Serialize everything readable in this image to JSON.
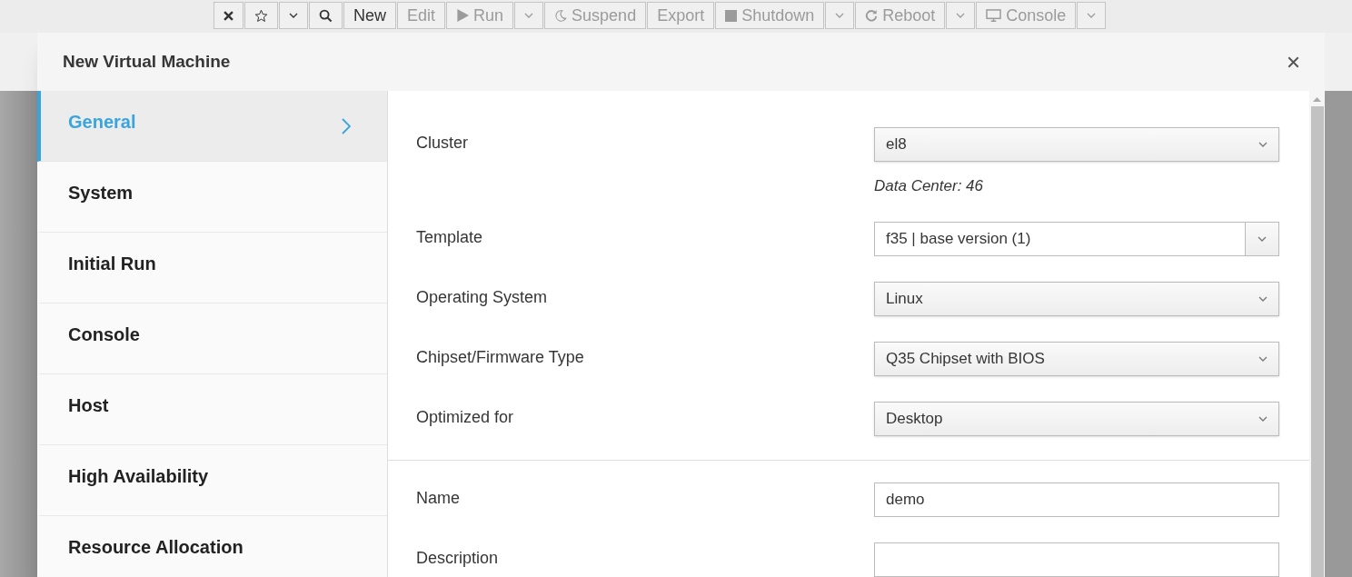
{
  "toolbar": [
    {
      "kind": "close"
    },
    {
      "kind": "star"
    },
    {
      "kind": "caret"
    },
    {
      "kind": "search"
    },
    {
      "kind": "text",
      "label": "New"
    },
    {
      "kind": "text",
      "label": "Edit",
      "disabled": true
    },
    {
      "kind": "run",
      "label": "Run",
      "disabled": true
    },
    {
      "kind": "caret",
      "disabled": true
    },
    {
      "kind": "suspend",
      "label": "Suspend",
      "disabled": true
    },
    {
      "kind": "text",
      "label": "Export",
      "disabled": true
    },
    {
      "kind": "shutdown",
      "label": "Shutdown",
      "disabled": true
    },
    {
      "kind": "caret",
      "disabled": true
    },
    {
      "kind": "reboot",
      "label": "Reboot",
      "disabled": true
    },
    {
      "kind": "caret",
      "disabled": true
    },
    {
      "kind": "console",
      "label": "Console",
      "disabled": true
    },
    {
      "kind": "caret",
      "disabled": true
    }
  ],
  "dialog": {
    "title": "New Virtual Machine",
    "sidebar": {
      "items": [
        {
          "label": "General",
          "selected": true
        },
        {
          "label": "System",
          "selected": false
        },
        {
          "label": "Initial Run",
          "selected": false
        },
        {
          "label": "Console",
          "selected": false
        },
        {
          "label": "Host",
          "selected": false
        },
        {
          "label": "High Availability",
          "selected": false
        },
        {
          "label": "Resource Allocation",
          "selected": false
        }
      ]
    },
    "sections": [
      [
        {
          "kind": "select",
          "label": "Cluster",
          "value": "el8",
          "helper": "Data Center: 46"
        },
        {
          "kind": "combo",
          "label": "Template",
          "value": "f35 | base version (1)"
        },
        {
          "kind": "select",
          "label": "Operating System",
          "value": "Linux"
        },
        {
          "kind": "select",
          "label": "Chipset/Firmware Type",
          "value": "Q35 Chipset with BIOS"
        },
        {
          "kind": "select",
          "label": "Optimized for",
          "value": "Desktop"
        }
      ],
      [
        {
          "kind": "text",
          "label": "Name",
          "value": "demo"
        },
        {
          "kind": "text",
          "label": "Description"
        }
      ]
    ]
  }
}
